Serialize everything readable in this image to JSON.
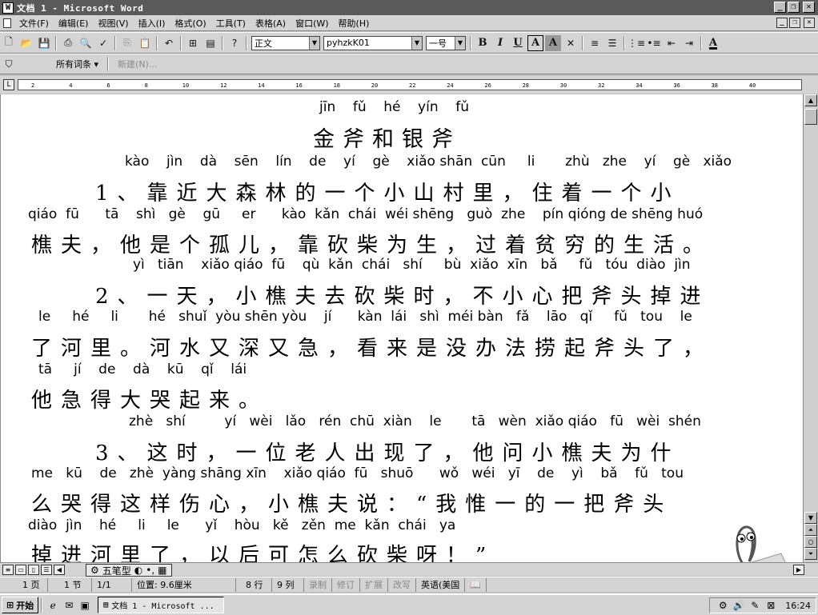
{
  "window": {
    "title": "文档 1 - Microsoft Word",
    "controls": [
      "_",
      "❐",
      "✕"
    ]
  },
  "menu": [
    "文件(F)",
    "编辑(E)",
    "视图(V)",
    "插入(I)",
    "格式(O)",
    "工具(T)",
    "表格(A)",
    "窗口(W)",
    "帮助(H)"
  ],
  "toolbar": {
    "style": "正文",
    "font": "pyhzkK01",
    "size": "一号",
    "bold": "B",
    "italic": "I",
    "underline": "U",
    "border_a": "A",
    "shade_a": "A",
    "font_color": "A"
  },
  "toolbar2": {
    "all_entries": "所有词条 ▾",
    "new": "新建(N)..."
  },
  "ruler": [
    "2",
    "4",
    "6",
    "8",
    "10",
    "12",
    "14",
    "16",
    "18",
    "20",
    "22",
    "24",
    "26",
    "28",
    "30",
    "32",
    "34",
    "36",
    "38",
    "40"
  ],
  "document": {
    "lines": [
      {
        "type": "py",
        "text": "jīn    fǔ    hé    yín    fǔ"
      },
      {
        "type": "title",
        "text": "金斧和银斧"
      },
      {
        "type": "py",
        "text": "kào    jìn    dà    sēn    lín    de    yí    gè    xiǎo shān  cūn     li       zhù   zhe    yí    gè   xiǎo"
      },
      {
        "type": "hz",
        "text": "1、靠近大森林的一个小山村里，住着一个小"
      },
      {
        "type": "py",
        "text": "qiáo  fū      tā    shì   gè    gū     er      kào  kǎn  chái  wéi shēng   guò  zhe    pín qióng de shēng huó"
      },
      {
        "type": "hz",
        "text": "樵夫，他是个孤儿，靠砍柴为生，过着贫穷的生活。"
      },
      {
        "type": "py",
        "text": "yì   tiān    xiǎo qiáo  fū    qù  kǎn  chái   shí     bù  xiǎo  xīn   bǎ     fǔ   tóu  diào  jìn"
      },
      {
        "type": "hz",
        "text": "2、一天，小樵夫去砍柴时，不小心把斧头掉进"
      },
      {
        "type": "py",
        "text": "le     hé     li       hé   shuǐ  yòu shēn yòu    jí      kàn  lái   shì  méi bàn   fǎ    lāo   qǐ     fǔ   tou    le"
      },
      {
        "type": "hz",
        "text": "了河里。河水又深又急，看来是没办法捞起斧头了，"
      },
      {
        "type": "py",
        "text": "tā     jí    de    dà    kū    qǐ    lái"
      },
      {
        "type": "hz",
        "text": "他急得大哭起来。"
      },
      {
        "type": "py",
        "text": "zhè   shí         yí   wèi   lǎo   rén  chū  xiàn    le       tā   wèn  xiǎo qiáo   fū   wèi  shén"
      },
      {
        "type": "hz",
        "text": "3、这时，一位老人出现了，他问小樵夫为什"
      },
      {
        "type": "py",
        "text": "me   kū    de   zhè  yàng shāng xīn    xiǎo qiáo  fū   shuō      wǒ   wéi   yī    de    yì    bǎ    fǔ   tou"
      },
      {
        "type": "hz",
        "text": "么哭得这样伤心，小樵夫说：“我惟一的一把斧头"
      },
      {
        "type": "py",
        "text": "diào  jìn    hé     li     le      yǐ    hòu   kě   zěn  me  kǎn  chái   ya"
      },
      {
        "type": "hz",
        "text": "掉进河里了，以后可怎么砍柴呀！”"
      }
    ]
  },
  "ime": {
    "label": "五笔型",
    "moon": "◐",
    "punct": "•,",
    "kb": "▦"
  },
  "status": {
    "page": "1 页",
    "section": "1 节",
    "pages": "1/1",
    "position": "位置: 9.6厘米",
    "row": "8 行",
    "col": "9 列",
    "rec": "录制",
    "trk": "修订",
    "ext": "扩展",
    "ovr": "改写",
    "lang": "英语(美国"
  },
  "taskbar": {
    "start": "开始",
    "task": "文档 1 - Microsoft ...",
    "time": "16:24"
  }
}
